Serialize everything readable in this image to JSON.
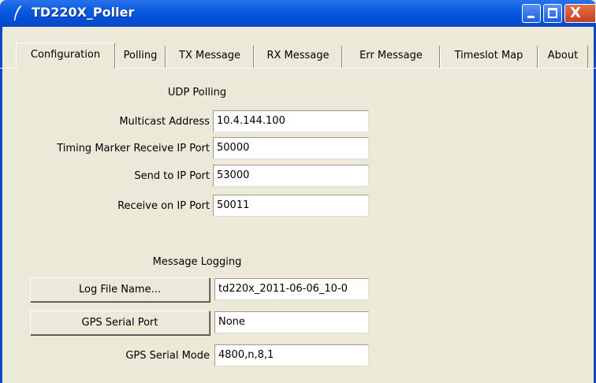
{
  "window": {
    "title": "TD220X_Poller",
    "controls": {
      "minimize_icon": "minimize-icon",
      "maximize_icon": "maximize-icon",
      "close_icon": "close-icon",
      "close_glyph": "X"
    }
  },
  "tabs": [
    {
      "label": "Configuration",
      "active": true
    },
    {
      "label": "Polling"
    },
    {
      "label": "TX Message"
    },
    {
      "label": "RX Message"
    },
    {
      "label": "Err Message"
    },
    {
      "label": "Timeslot Map"
    },
    {
      "label": "About"
    }
  ],
  "udp": {
    "heading": "UDP Polling",
    "rows": [
      {
        "label": "Multicast Address",
        "value": "10.4.144.100"
      },
      {
        "label": "Timing Marker Receive IP Port",
        "value": "50000"
      },
      {
        "label": "Send to IP Port",
        "value": "53000"
      },
      {
        "label": "Receive on IP Port",
        "value": "50011"
      }
    ]
  },
  "logging": {
    "heading": "Message Logging",
    "log_file_button": "Log File Name...",
    "log_file_value": "td220x_2011-06-06_10-0",
    "gps_port_button": "GPS Serial Port",
    "gps_port_value": "None",
    "gps_mode_label": "GPS Serial Mode",
    "gps_mode_value": "4800,n,8,1"
  },
  "colors": {
    "titlebar": "#0a5ae0",
    "window_bg": "#ece9d8",
    "close_button": "#c3401e"
  }
}
